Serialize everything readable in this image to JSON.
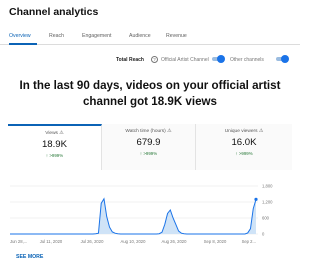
{
  "page": {
    "title": "Channel analytics"
  },
  "tabs": [
    {
      "label": "Overview",
      "active": true
    },
    {
      "label": "Reach",
      "active": false
    },
    {
      "label": "Engagement",
      "active": false
    },
    {
      "label": "Audience",
      "active": false
    },
    {
      "label": "Revenue",
      "active": false
    }
  ],
  "reach_toggle": {
    "label": "Total Reach",
    "help_icon": "help-circle-icon",
    "help_glyph": "?",
    "option1_label": "Official Artist Channel",
    "option2_label": "Other channels",
    "option1_on": true,
    "option2_on": true
  },
  "headline": "In the last 90 days, videos on your official artist channel got 18.9K views",
  "metrics": [
    {
      "label": "Views",
      "icon": "warning-icon",
      "icon_glyph": "⚠",
      "value": "18.9K",
      "delta": ">999%",
      "delta_icon": "arrow-up-icon",
      "delta_glyph": "↑",
      "active": true
    },
    {
      "label": "Watch time (hours)",
      "icon": "warning-icon",
      "icon_glyph": "⚠",
      "value": "679.9",
      "delta": ">999%",
      "delta_icon": "arrow-up-icon",
      "delta_glyph": "↑",
      "active": false
    },
    {
      "label": "Unique viewers",
      "icon": "warning-icon",
      "icon_glyph": "⚠",
      "value": "16.0K",
      "delta": ">999%",
      "delta_icon": "arrow-up-icon",
      "delta_glyph": "↑",
      "active": false
    }
  ],
  "colors": {
    "accent": "#0b63b6",
    "line": "#1a73e8",
    "area": "#cfe3f7",
    "positive": "#2a7a3a"
  },
  "chart_data": {
    "type": "area",
    "x_tick_labels": [
      "Jun 28,...",
      "Jul 11, 2020",
      "Jul 26, 2020",
      "Aug 10, 2020",
      "Aug 26, 2020",
      "Sep 8, 2020",
      "Sep 2..."
    ],
    "y_tick_labels": [
      "1,800",
      "1,200",
      "600",
      "0"
    ],
    "ylim": [
      0,
      1800
    ],
    "grid": true,
    "series": [
      {
        "values": [
          0,
          0,
          0,
          0,
          0,
          0,
          0,
          0,
          0,
          0,
          0,
          0,
          0,
          0,
          0,
          0,
          0,
          0,
          0,
          0,
          0,
          0,
          0,
          0,
          0,
          0,
          0,
          0,
          0,
          0,
          0,
          10,
          30,
          1150,
          1320,
          650,
          260,
          80,
          30,
          10,
          0,
          0,
          0,
          0,
          0,
          0,
          0,
          0,
          0,
          0,
          0,
          0,
          0,
          0,
          10,
          70,
          360,
          770,
          900,
          600,
          360,
          110,
          30,
          10,
          0,
          0,
          0,
          0,
          0,
          0,
          0,
          0,
          0,
          0,
          0,
          0,
          0,
          0,
          0,
          0,
          0,
          0,
          0,
          0,
          0,
          0,
          40,
          200,
          950,
          1300
        ]
      }
    ]
  },
  "see_more": "SEE MORE"
}
